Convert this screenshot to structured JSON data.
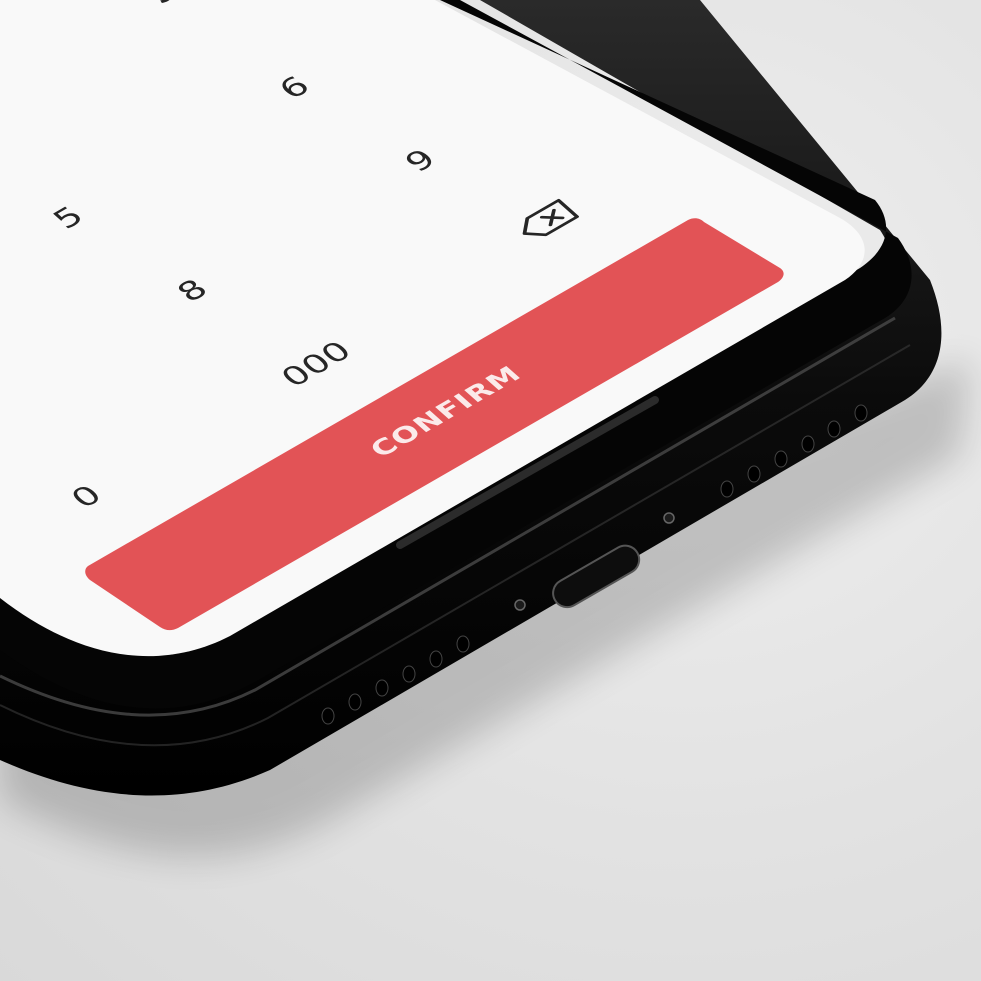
{
  "keypad": {
    "keys": [
      "5",
      "6",
      "9",
      "8",
      "000",
      "0"
    ],
    "delete_icon": "backspace-icon"
  },
  "confirm_button": {
    "label": "CONFIRM",
    "color": "#e25356"
  },
  "colors": {
    "screen": "#f9f9f9",
    "bezel": "#0a0a0a",
    "home_indicator": "#2b2b2b"
  }
}
